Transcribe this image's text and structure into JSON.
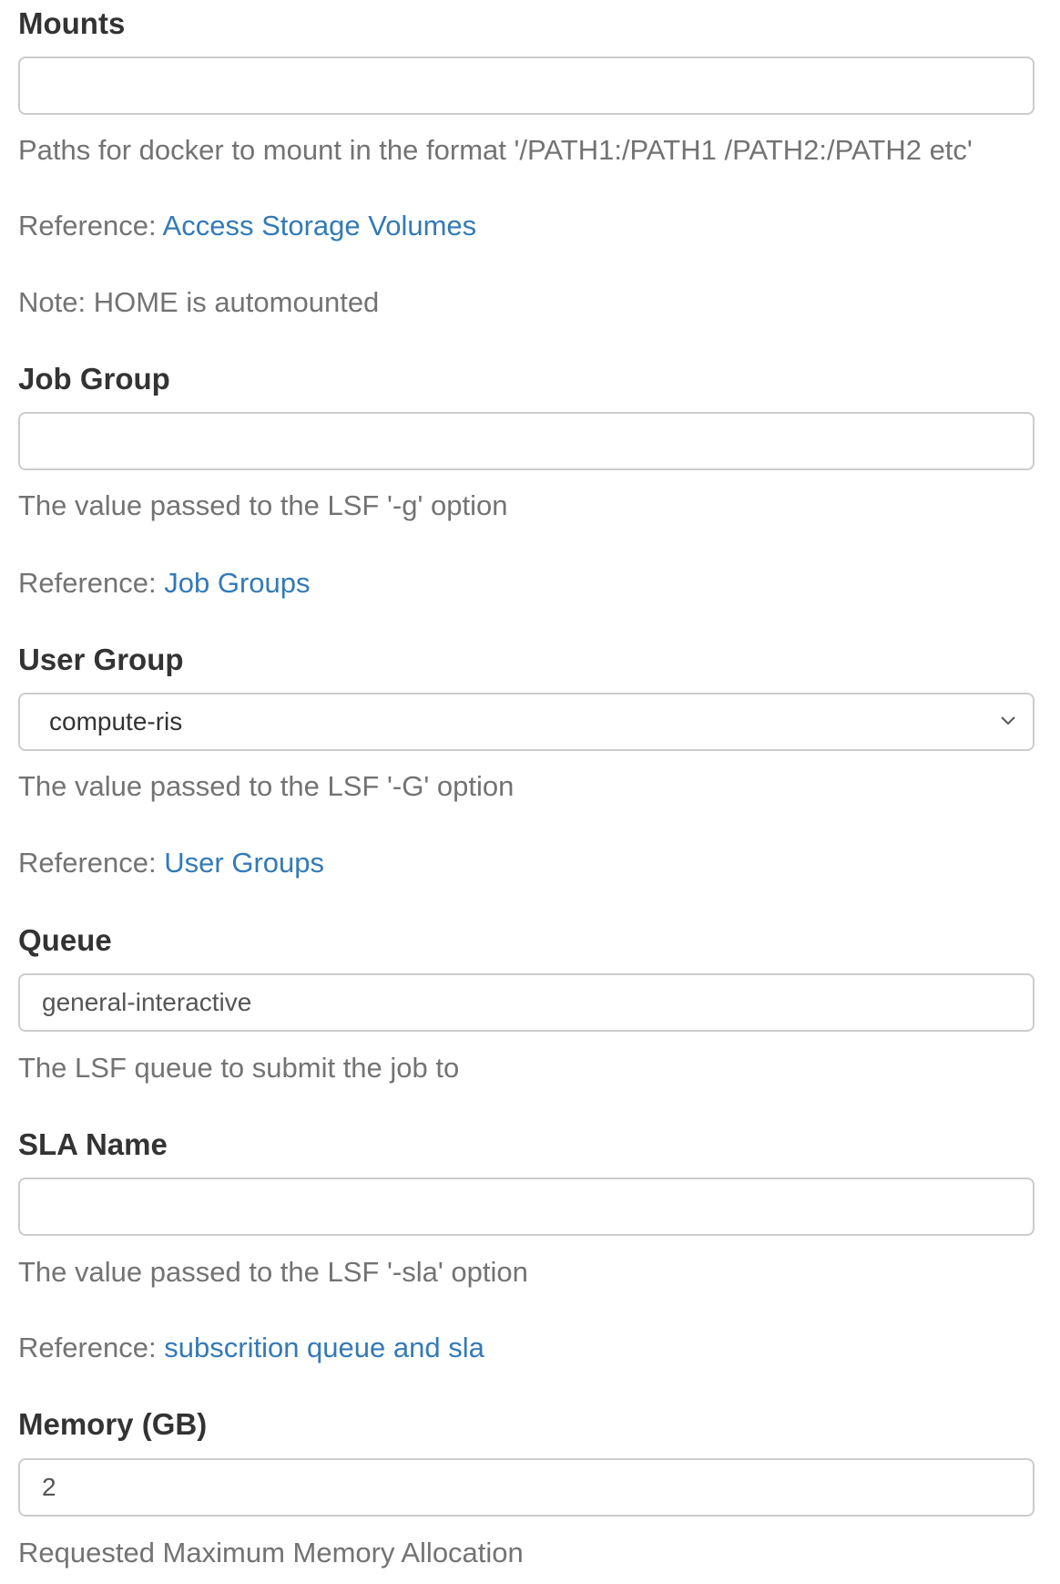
{
  "mounts": {
    "label": "Mounts",
    "value": "",
    "help": "Paths for docker to mount in the format '/PATH1:/PATH1 /PATH2:/PATH2 etc'",
    "reference_prefix": "Reference: ",
    "reference_link": "Access Storage Volumes",
    "note": "Note: HOME is automounted"
  },
  "job_group": {
    "label": "Job Group",
    "value": "",
    "help": "The value passed to the LSF '-g' option",
    "reference_prefix": "Reference: ",
    "reference_link": "Job Groups"
  },
  "user_group": {
    "label": "User Group",
    "selected": "compute-ris",
    "help": "The value passed to the LSF '-G' option",
    "reference_prefix": "Reference: ",
    "reference_link": "User Groups"
  },
  "queue": {
    "label": "Queue",
    "value": "general-interactive",
    "help": "The LSF queue to submit the job to"
  },
  "sla_name": {
    "label": "SLA Name",
    "value": "",
    "help": "The value passed to the LSF '-sla' option",
    "reference_prefix": "Reference: ",
    "reference_link": "subscrition queue and sla"
  },
  "memory": {
    "label": "Memory (GB)",
    "value": "2",
    "help": "Requested Maximum Memory Allocation"
  },
  "colors": {
    "text": "#333333",
    "help_text": "#737373",
    "link": "#337ab7",
    "border": "#cccccc"
  }
}
